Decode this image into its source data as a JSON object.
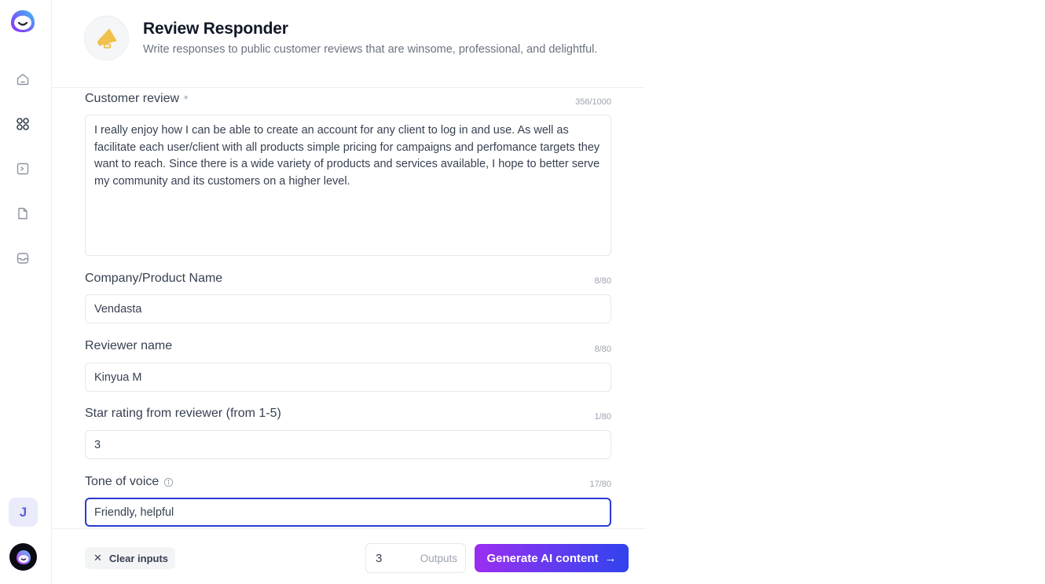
{
  "sidebar": {
    "logo": "jasper-logo-icon",
    "nav_items": [
      {
        "name": "home",
        "icon": "home-icon"
      },
      {
        "name": "apps",
        "icon": "grid-icon"
      },
      {
        "name": "commands",
        "icon": "terminal-icon"
      },
      {
        "name": "documents",
        "icon": "document-icon"
      },
      {
        "name": "inbox",
        "icon": "inbox-icon"
      }
    ],
    "user_initial": "J",
    "assistant_icon": "bot-avatar-icon"
  },
  "header": {
    "icon": "megaphone-icon",
    "title": "Review Responder",
    "subtitle": "Write responses to public customer reviews that are winsome, professional, and delightful."
  },
  "form": {
    "customer_review": {
      "label": "Customer review",
      "required_mark": "*",
      "counter": "356/1000",
      "value": "I really enjoy how I can be able to create an account for any client to log in and use. As well as facilitate each user/client with all products simple pricing for campaigns and perfomance targets they want to reach. Since there is a wide variety of products and services available, I hope to better serve my community and its customers on a higher level."
    },
    "company_name": {
      "label": "Company/Product Name",
      "counter": "8/80",
      "value": "Vendasta"
    },
    "reviewer_name": {
      "label": "Reviewer name",
      "counter": "8/80",
      "value": "Kinyua M"
    },
    "star_rating": {
      "label": "Star rating from reviewer (from 1-5)",
      "counter": "1/80",
      "value": "3"
    },
    "tone_of_voice": {
      "label": "Tone of voice",
      "counter": "17/80",
      "value": "Friendly, helpful"
    }
  },
  "footer": {
    "clear_label": "Clear inputs",
    "outputs_value": "3",
    "outputs_label": "Outputs",
    "generate_label": "Generate AI content",
    "generate_arrow": "→",
    "clear_glyph": "✕"
  },
  "colors": {
    "accent_start": "#9b2ef0",
    "accent_end": "#3142ee",
    "focus_border": "#2a3bd1",
    "header_icon": "#f1c04a"
  }
}
